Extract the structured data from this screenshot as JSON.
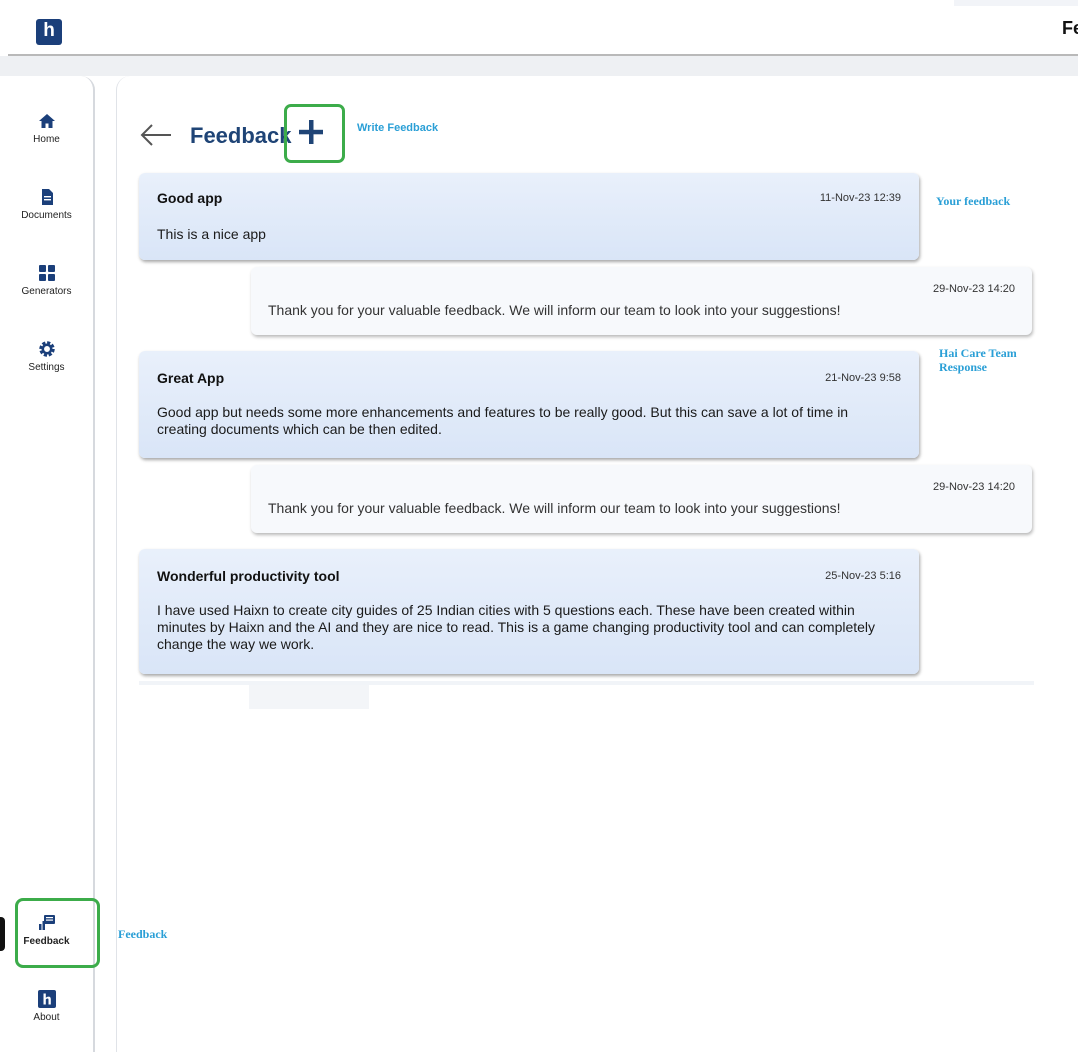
{
  "app": {
    "logo_letter": "h",
    "top_title": "Feedback"
  },
  "sidebar": {
    "items": [
      {
        "label": "Home",
        "icon": "home-icon"
      },
      {
        "label": "Documents",
        "icon": "document-icon"
      },
      {
        "label": "Generators",
        "icon": "grid-icon"
      },
      {
        "label": "Settings",
        "icon": "gear-icon"
      },
      {
        "label": "Feedback",
        "icon": "feedback-icon",
        "active": true
      },
      {
        "label": "About",
        "icon": "about-logo-icon"
      }
    ]
  },
  "header": {
    "title": "Feedback",
    "write_label": "Write Feedback"
  },
  "feedback": [
    {
      "title": "Good app",
      "date": "11-Nov-23 12:39",
      "body": "This is a nice app",
      "reply": {
        "date": "29-Nov-23 14:20",
        "body": "Thank you for your valuable feedback. We will inform our team to look into your suggestions!"
      }
    },
    {
      "title": "Great App",
      "date": "21-Nov-23 9:58",
      "body": "Good app but needs some more enhancements and features to be really good. But this can save a lot of time in creating documents which can be then edited.",
      "reply": {
        "date": "29-Nov-23 14:20",
        "body": "Thank you for your valuable feedback. We will inform our team to look into your suggestions!"
      }
    },
    {
      "title": "Wonderful productivity tool",
      "date": "25-Nov-23 5:16",
      "body": "I have used Haixn to create city guides of 25 Indian cities with 5 questions each. These have been created within minutes by Haixn and the AI and they are nice to read. This is a game changing productivity tool and can completely change the way we work."
    }
  ],
  "annotations": {
    "your_feedback": "Your feedback",
    "team_response": "Hai Care Team Response",
    "feedback_nav": "Feedback"
  },
  "colors": {
    "brand_navy": "#1b3f7a",
    "title_blue": "#1f4476",
    "accent_cyan": "#2a9fd6",
    "highlight_green": "#3cac4a"
  }
}
